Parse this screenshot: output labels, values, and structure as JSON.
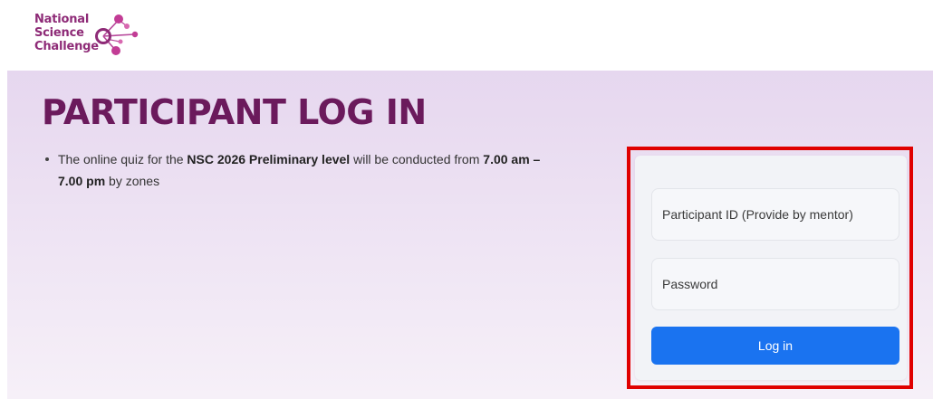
{
  "logo": {
    "line1": "National",
    "line2": "Science",
    "line3": "Challenge"
  },
  "hero": {
    "title": "PARTICIPANT LOG IN",
    "notice": {
      "part1": "The online quiz for the ",
      "bold1": "NSC 2026 Preliminary level",
      "part2": " will be conducted from ",
      "bold2": "7.00 am – 7.00 pm",
      "part3": " by zones"
    }
  },
  "login": {
    "participant_id_placeholder": "Participant ID (Provide by mentor)",
    "password_placeholder": "Password",
    "submit_label": "Log in"
  },
  "colors": {
    "brand": "#8e2b77",
    "title": "#6b1a5c",
    "button": "#1a73f0",
    "highlight": "#e00000"
  }
}
